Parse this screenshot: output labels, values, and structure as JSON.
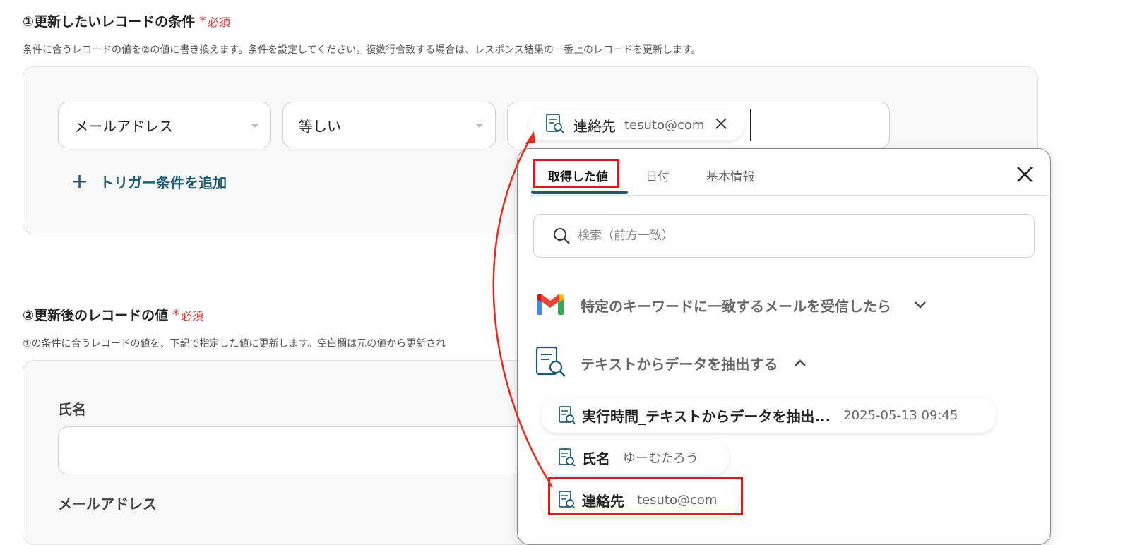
{
  "section1": {
    "title": "①更新したいレコードの条件",
    "required": "必須",
    "description": "条件に合うレコードの値を②の値に書き換えます。条件を設定してください。複数行合致する場合は、レスポンス結果の一番上のレコードを更新します。",
    "condition": {
      "field": "メールアドレス",
      "operator": "等しい",
      "value_chip": {
        "label": "連絡先",
        "value": "tesuto@com"
      }
    },
    "add_trigger": "トリガー条件を追加"
  },
  "section2": {
    "title": "②更新後のレコードの値",
    "required": "必須",
    "description": "①の条件に合うレコードの値を、下記で指定した値に更新します。空白欄は元の値から更新され",
    "fields": [
      {
        "label": "氏名",
        "value": ""
      },
      {
        "label": "メールアドレス"
      }
    ]
  },
  "picker": {
    "tabs": [
      "取得した値",
      "日付",
      "基本情報"
    ],
    "active_tab": 0,
    "search_placeholder": "検索（前方一致）",
    "groups": [
      {
        "icon": "gmail-icon",
        "title": "特定のキーワードに一致するメールを受信したら",
        "expanded": false
      },
      {
        "icon": "document-search-icon",
        "title": "テキストからデータを抽出する",
        "expanded": true
      }
    ],
    "items": [
      {
        "label": "実行時間_テキストからデータを抽出...",
        "value": "2025-05-13 09:45"
      },
      {
        "label": "氏名",
        "value": "ゆーむたろう"
      },
      {
        "label": "連絡先",
        "value": "tesuto@com"
      }
    ]
  },
  "colors": {
    "accent": "#1c5b74",
    "required": "#e23b3b",
    "highlight_box": "#e01818",
    "annotation_arrow": "#e82a1a"
  }
}
